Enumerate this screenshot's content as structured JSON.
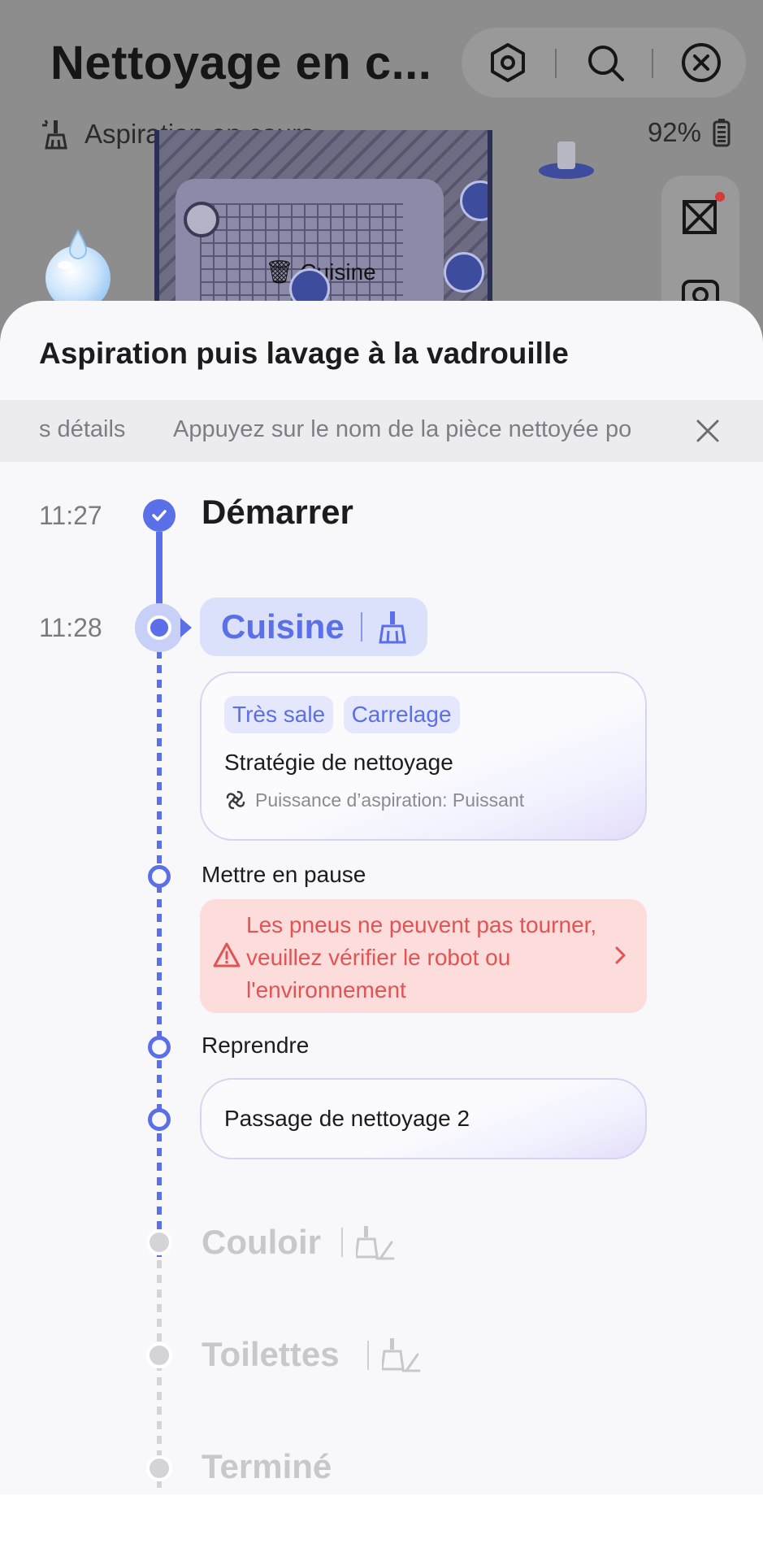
{
  "header": {
    "title": "Nettoyage en c...",
    "actions": [
      "settings-icon",
      "search-icon",
      "close-icon"
    ]
  },
  "status": {
    "mode_text": "Aspiration en cours",
    "battery": "92%"
  },
  "map": {
    "room_label": "Cuisine"
  },
  "sheet": {
    "title": "Aspiration puis lavage à la vadrouille",
    "banner": {
      "segment_left": "s détails",
      "segment_right": "Appuyez sur le nom de la pièce nettoyée po"
    }
  },
  "timeline": {
    "start": {
      "time": "11:27",
      "label": "Démarrer"
    },
    "current_room": {
      "time": "11:28",
      "name": "Cuisine",
      "tags": [
        "Très sale",
        "Carrelage"
      ],
      "strategy_title": "Stratégie de nettoyage",
      "power_text": "Puissance d’aspiration: Puissant"
    },
    "pause_label": "Mettre en pause",
    "error_text": "Les pneus ne peuvent pas tourner, veuillez vérifier le robot ou l'environnement",
    "resume_label": "Reprendre",
    "pass_text": "Passage de nettoyage 2",
    "upcoming": [
      "Couloir",
      "Toilettes"
    ],
    "end_label": "Terminé"
  },
  "colors": {
    "accent": "#5b6fe8",
    "error_bg": "#fddcdc",
    "error_text": "#e05454",
    "pending": "#c8c8cc"
  }
}
